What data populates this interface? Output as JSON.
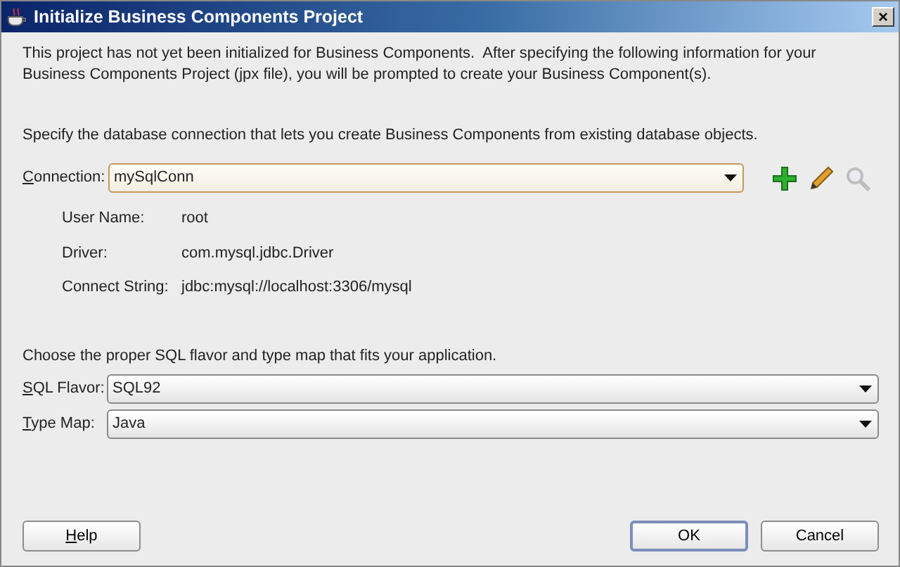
{
  "window": {
    "title": "Initialize Business Components Project",
    "close": "×"
  },
  "intro": "This project has not yet been initialized for Business Components.  After specifying the following information for your Business Components Project (jpx file), you will be prompted to create your Business Component(s).",
  "connection_prompt": "Specify the database connection that lets you create Business Components from existing database objects.",
  "connection": {
    "label": "Connection:",
    "underline_first": true,
    "value": "mySqlConn",
    "focused": true
  },
  "connection_tools": [
    {
      "kind": "add",
      "disabled": false
    },
    {
      "kind": "edit",
      "disabled": false
    },
    {
      "kind": "browse",
      "disabled": true
    }
  ],
  "details": [
    {
      "label": "User Name:",
      "value": "root"
    },
    {
      "label": "Driver:",
      "value": "com.mysql.jdbc.Driver"
    },
    {
      "label": "Connect String:",
      "value": "jdbc:mysql://localhost:3306/mysql"
    }
  ],
  "sql_prompt": "Choose the proper SQL flavor and type map that fits your application.",
  "selects": [
    {
      "label": "SQL Flavor:",
      "underline_first": true,
      "value": "SQL92",
      "focused": false
    },
    {
      "label": "Type Map:",
      "underline_first": true,
      "value": "Java",
      "focused": false
    }
  ],
  "buttons": [
    {
      "label": "Help",
      "underline_first": true,
      "default": false,
      "kind": "help"
    },
    {
      "label": "OK",
      "underline_first": false,
      "default": true,
      "kind": "action"
    },
    {
      "label": "Cancel",
      "underline_first": false,
      "default": false,
      "kind": "action"
    }
  ]
}
